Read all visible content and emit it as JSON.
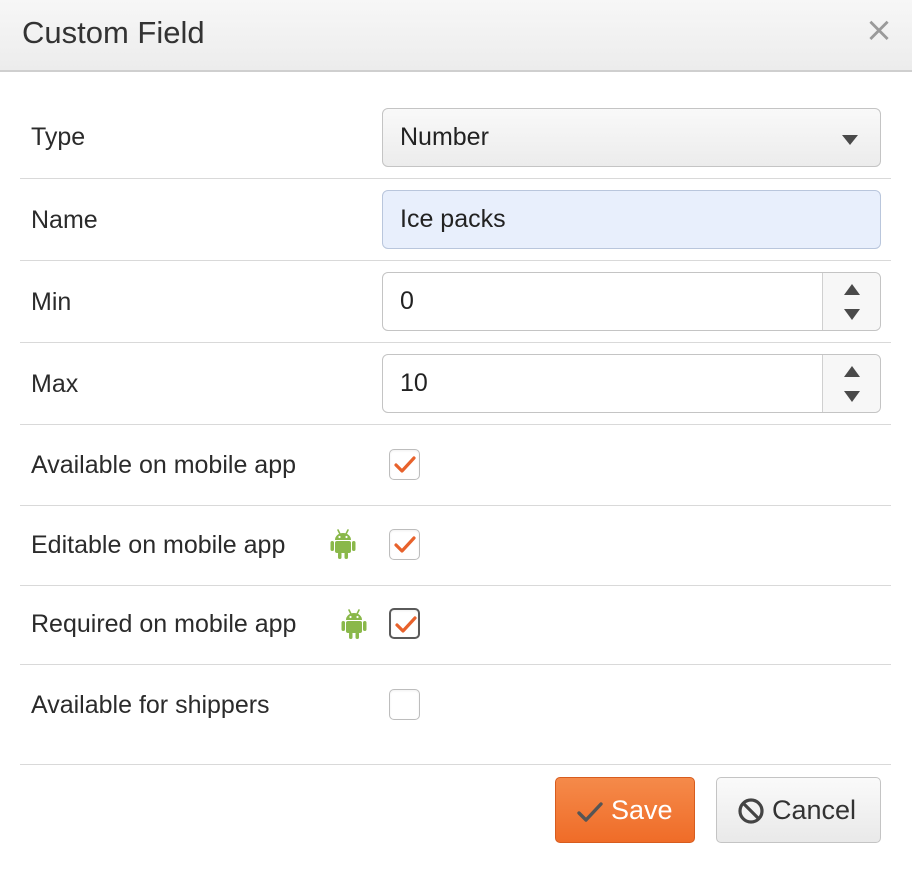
{
  "dialog": {
    "title": "Custom Field",
    "close_glyph": "×"
  },
  "fields": {
    "type": {
      "label": "Type",
      "value": "Number"
    },
    "name": {
      "label": "Name",
      "value": "Ice packs"
    },
    "min": {
      "label": "Min",
      "value": "0"
    },
    "max": {
      "label": "Max",
      "value": "10"
    }
  },
  "checkboxes": {
    "available_mobile": {
      "label": "Available on mobile app",
      "checked": true
    },
    "editable_mobile": {
      "label": "Editable on mobile app",
      "checked": true,
      "icon": "android-icon"
    },
    "required_mobile": {
      "label": "Required on mobile app",
      "checked": true,
      "icon": "android-icon"
    },
    "available_shippers": {
      "label": "Available for shippers",
      "checked": false
    }
  },
  "buttons": {
    "save": {
      "label": "Save",
      "icon": "checkmark-icon"
    },
    "cancel": {
      "label": "Cancel",
      "icon": "ban-icon"
    }
  },
  "colors": {
    "accent": "#f07a3a",
    "check": "#e8622c",
    "android": "#8ab84a"
  }
}
